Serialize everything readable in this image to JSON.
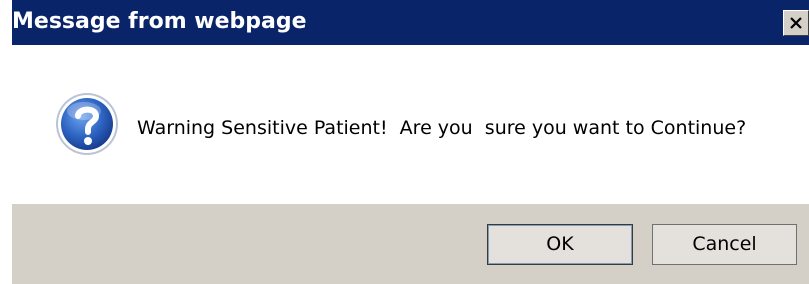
{
  "dialog": {
    "title": "Message from webpage",
    "close_glyph": "X",
    "icon": "question-icon",
    "message": "Warning Sensitive Patient!  Are you  sure you want to Continue?",
    "buttons": {
      "ok_label": "OK",
      "cancel_label": "Cancel"
    }
  },
  "colors": {
    "titlebar": "#0a246a",
    "footer": "#d4d0c8",
    "icon_blue": "#2a5fb8"
  }
}
